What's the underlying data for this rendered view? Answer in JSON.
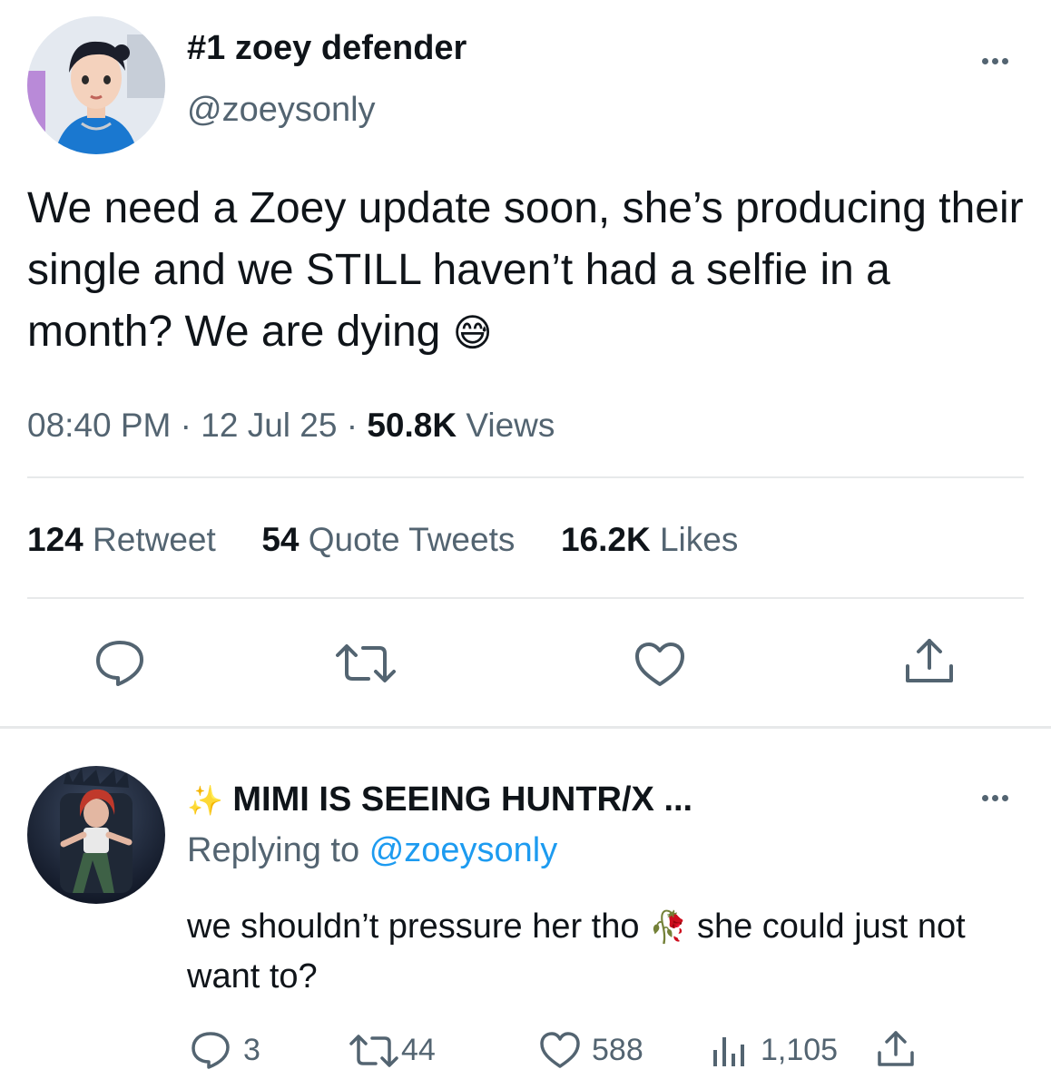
{
  "tweet": {
    "display_name": "#1 zoey defender",
    "handle": "@zoeysonly",
    "text": "We need a Zoey update soon, she’s producing their single and we STILL haven’t had a selfie in a month? We are dying",
    "emoji": "😅",
    "time": "08:40 PM",
    "date": "12 Jul 25",
    "separator": "·",
    "views_count": "50.8K",
    "views_label": "Views",
    "stats": {
      "retweets_count": "124",
      "retweets_label": "Retweet",
      "quotes_count": "54",
      "quotes_label": "Quote Tweets",
      "likes_count": "16.2K",
      "likes_label": "Likes"
    }
  },
  "reply": {
    "sparkle": "✨",
    "display_name": "MIMI IS SEEING HUNTR/X ...",
    "replying_prefix": "Replying to",
    "replying_to": "@zoeysonly",
    "text_part1": "we shouldn’t pressure her tho",
    "emoji": "🥀",
    "text_part2": "she could just not want to?",
    "counts": {
      "replies": "3",
      "retweets": "44",
      "likes": "588",
      "views": "1,105"
    }
  },
  "icons": {
    "more": "more-dots-icon",
    "reply": "reply-bubble-icon",
    "retweet": "retweet-icon",
    "like": "heart-icon",
    "share": "share-icon",
    "views": "bar-chart-icon"
  },
  "colors": {
    "text": "#0f1419",
    "muted": "#536471",
    "link": "#1d9bf0",
    "divider": "#e7e9ea"
  }
}
